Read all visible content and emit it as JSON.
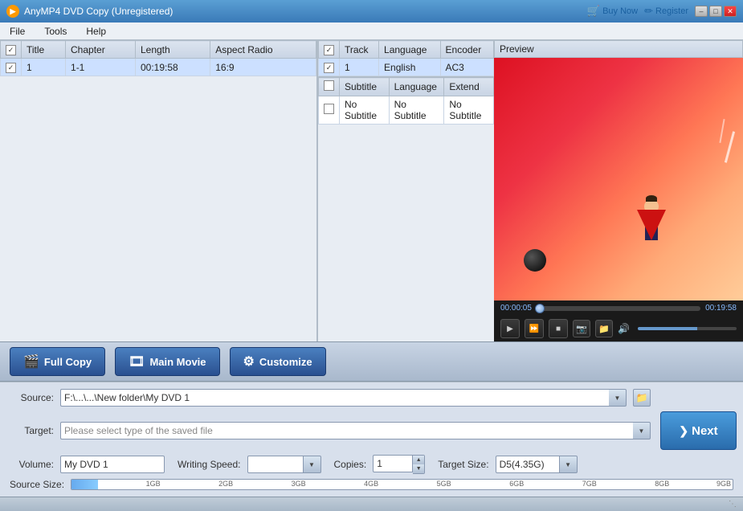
{
  "titleBar": {
    "title": "AnyMP4 DVD Copy (Unregistered)",
    "minimizeLabel": "–",
    "maximizeLabel": "□",
    "closeLabel": "✕",
    "buyNow": "Buy Now",
    "register": "Register"
  },
  "menuBar": {
    "items": [
      "File",
      "Tools",
      "Help"
    ]
  },
  "videoTable": {
    "columns": [
      {
        "label": "",
        "type": "check"
      },
      {
        "label": "Title"
      },
      {
        "label": "Chapter"
      },
      {
        "label": "Length"
      },
      {
        "label": "Aspect Radio"
      }
    ],
    "rows": [
      {
        "checked": true,
        "title": "1",
        "chapter": "1-1",
        "length": "00:19:58",
        "aspect": "16:9",
        "selected": true
      }
    ]
  },
  "audioTable": {
    "columns": [
      {
        "label": "",
        "type": "check"
      },
      {
        "label": "Track"
      },
      {
        "label": "Language"
      },
      {
        "label": "Encoder"
      }
    ],
    "rows": [
      {
        "checked": true,
        "track": "1",
        "language": "English",
        "encoder": "AC3"
      }
    ]
  },
  "subtitleTable": {
    "columns": [
      {
        "label": "",
        "type": "check"
      },
      {
        "label": "Subtitle"
      },
      {
        "label": "Language"
      },
      {
        "label": "Extend"
      }
    ],
    "rows": [
      {
        "checked": false,
        "subtitle": "No Subtitle",
        "language": "No Subtitle",
        "extend": "No Subtitle"
      }
    ]
  },
  "preview": {
    "label": "Preview",
    "timeStart": "00:00:05",
    "timeEnd": "00:19:58",
    "progressPercent": 2
  },
  "copyButtons": {
    "fullCopy": "Full Copy",
    "mainMovie": "Main Movie",
    "customize": "Customize"
  },
  "settings": {
    "sourceLabel": "Source:",
    "sourceValue": "F:\\...\\...\\New folder\\My DVD 1",
    "targetLabel": "Target:",
    "targetValue": "Please select type of the saved file",
    "volumeLabel": "Volume:",
    "volumeValue": "My DVD 1",
    "writingSpeedLabel": "Writing Speed:",
    "writingSpeedValue": "",
    "copiesLabel": "Copies:",
    "copiesValue": "1",
    "targetSizeLabel": "Target Size:",
    "targetSizeValue": "D5(4.35G)",
    "sourceSizeLabel": "Source Size:",
    "sizeMarks": [
      "1GB",
      "2GB",
      "3GB",
      "4GB",
      "5GB",
      "6GB",
      "7GB",
      "8GB",
      "9GB"
    ]
  },
  "nextButton": {
    "label": "Next",
    "arrow": "❯"
  },
  "statusBar": {
    "resizeGrip": "⋱"
  }
}
